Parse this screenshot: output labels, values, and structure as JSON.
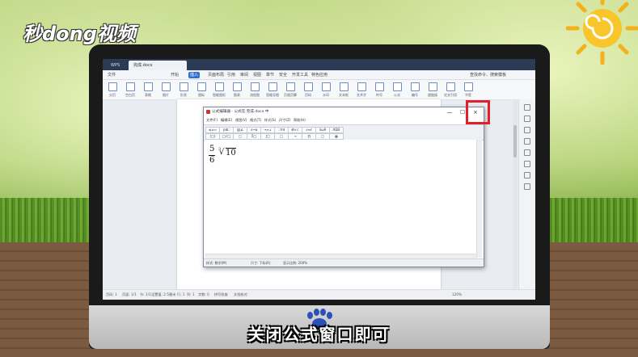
{
  "watermark": {
    "logo_text": "秒dong视频"
  },
  "caption": "关闭公式窗口即可",
  "wps": {
    "tabs": [
      {
        "label": "WPS"
      },
      {
        "label": "完成.docx"
      }
    ],
    "menu": [
      "文件",
      "开始",
      "插入",
      "页面布局",
      "引用",
      "审阅",
      "视图",
      "章节",
      "安全",
      "开发工具",
      "特色应用"
    ],
    "active_menu": "插入",
    "search_placeholder": "查找命令、搜索模板",
    "ribbon": [
      "分页",
      "空白页",
      "表格",
      "图片",
      "形状",
      "图标",
      "智能图形",
      "图表",
      "流程图",
      "思维导图",
      "页眉页脚",
      "页码",
      "水印",
      "文本框",
      "艺术字",
      "符号",
      "公式",
      "编号",
      "超链接",
      "交叉引用",
      "书签"
    ],
    "statusbar": {
      "page": "页码: 1",
      "pages": "页面: 1/1",
      "section": "节: 1/1",
      "pos": "设置值: 2.5厘米",
      "row": "行: 1",
      "col": "列: 1",
      "chars": "字数: 0",
      "spell": "拼写检查",
      "doc_check": "文档校对",
      "zoom": "120%"
    }
  },
  "equation_editor": {
    "title": "公式编辑器 - 公式在 完成.docx 中",
    "menu": [
      "文件(F)",
      "编辑(E)",
      "视图(V)",
      "格式(T)",
      "样式(S)",
      "尺寸(Z)",
      "帮助(H)"
    ],
    "toolbar_row1": [
      "≤≠≈",
      "∤ab∵",
      "∦∥∡",
      "±•⊗",
      "→⇔↓",
      "∴∀∃",
      "∉∩⊂",
      "∂∞ℓ",
      "λωθ",
      "ΛΩΘ"
    ],
    "toolbar_row2": [
      "(□)",
      "□√□",
      "□",
      "Σ□",
      "∫□",
      "□",
      "→",
      "∏",
      "□",
      "▦"
    ],
    "equation": {
      "numerator": "5",
      "denominator": "6",
      "root_index": "3",
      "radicand": "10"
    },
    "status": {
      "style": "样式: 数学(M)",
      "size": "尺寸: 下标(R)",
      "zoom": "显示比例: 200%"
    },
    "window_buttons": {
      "minimize": "—",
      "maximize": "☐",
      "close": "×"
    }
  }
}
